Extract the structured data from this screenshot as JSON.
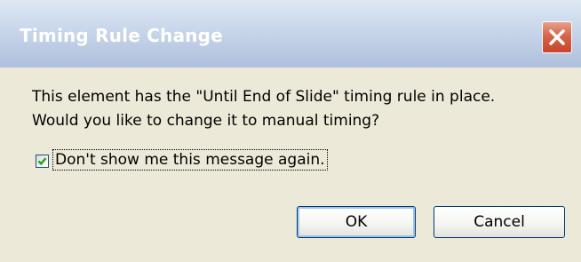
{
  "dialog": {
    "title": "Timing Rule Change",
    "close_icon": "close-icon",
    "message_line1": "This element has the \"Until End of Slide\" timing rule in place.",
    "message_line2": "Would you like to change it to manual timing?",
    "checkbox": {
      "label": "Don't show me this message again.",
      "checked": true
    },
    "buttons": {
      "ok_label": "OK",
      "cancel_label": "Cancel"
    }
  },
  "colors": {
    "titlebar_text": "#ffffff",
    "close_button": "#c8442d",
    "dialog_background": "#ece9d8",
    "checkmark": "#21a121"
  }
}
